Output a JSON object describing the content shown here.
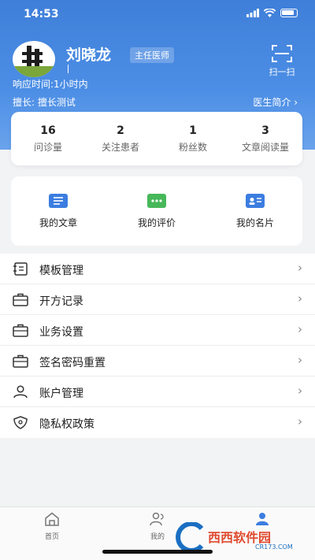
{
  "status_bar": {
    "time": "14:53"
  },
  "profile": {
    "name": "刘晓龙",
    "title": "主任医师",
    "response_time": "响应时间:1小时内",
    "specialty": "擅长: 擅长测试",
    "intro_link": "医生简介 ›",
    "scan_label": "扫一扫"
  },
  "stats": [
    {
      "value": "16",
      "label": "问诊量"
    },
    {
      "value": "2",
      "label": "关注患者"
    },
    {
      "value": "1",
      "label": "粉丝数"
    },
    {
      "value": "3",
      "label": "文章阅读量"
    }
  ],
  "shortcuts": [
    {
      "label": "我的文章",
      "icon": "article-icon",
      "color": "#3b7de0"
    },
    {
      "label": "我的评价",
      "icon": "comment-icon",
      "color": "#47b85a"
    },
    {
      "label": "我的名片",
      "icon": "card-icon",
      "color": "#3b7de0"
    }
  ],
  "menu": [
    {
      "label": "模板管理",
      "icon": "template-icon"
    },
    {
      "label": "开方记录",
      "icon": "briefcase-icon"
    },
    {
      "label": "业务设置",
      "icon": "briefcase-icon"
    },
    {
      "label": "签名密码重置",
      "icon": "briefcase-icon"
    },
    {
      "label": "账户管理",
      "icon": "user-icon"
    },
    {
      "label": "隐私权政策",
      "icon": "shield-icon"
    }
  ],
  "tabs": [
    {
      "label": "首页",
      "icon": "home-icon"
    },
    {
      "label": "我的",
      "icon": "patients-icon"
    },
    {
      "label": "",
      "icon": "profile-icon"
    }
  ],
  "watermark": {
    "text": "西西软件园",
    "sub": "CR173.COM"
  },
  "colors": {
    "header": "#4c8ee5",
    "accent": "#3b7de0",
    "green": "#47b85a"
  }
}
